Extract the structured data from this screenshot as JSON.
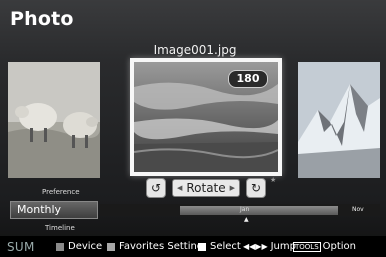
{
  "header": {
    "title": "Photo",
    "filename": "Image001.jpg"
  },
  "photo": {
    "rotation_badge": "180"
  },
  "rotate_controls": {
    "label": "Rotate"
  },
  "sort": {
    "preference_label": "Preference",
    "value": "Monthly",
    "timeline_label": "Timeline"
  },
  "timeline": {
    "start_label": "Jan",
    "end_label": "Nov"
  },
  "help_bar": {
    "sum": "SUM",
    "device": "Device",
    "favorites": "Favorites Setting",
    "select": "Select",
    "jump": "Jump",
    "tools": "TOOLS",
    "option": "Option",
    "colors": {
      "device": "#8a8a8a",
      "favorites": "#a8a8a8",
      "select": "#ffffff"
    }
  }
}
